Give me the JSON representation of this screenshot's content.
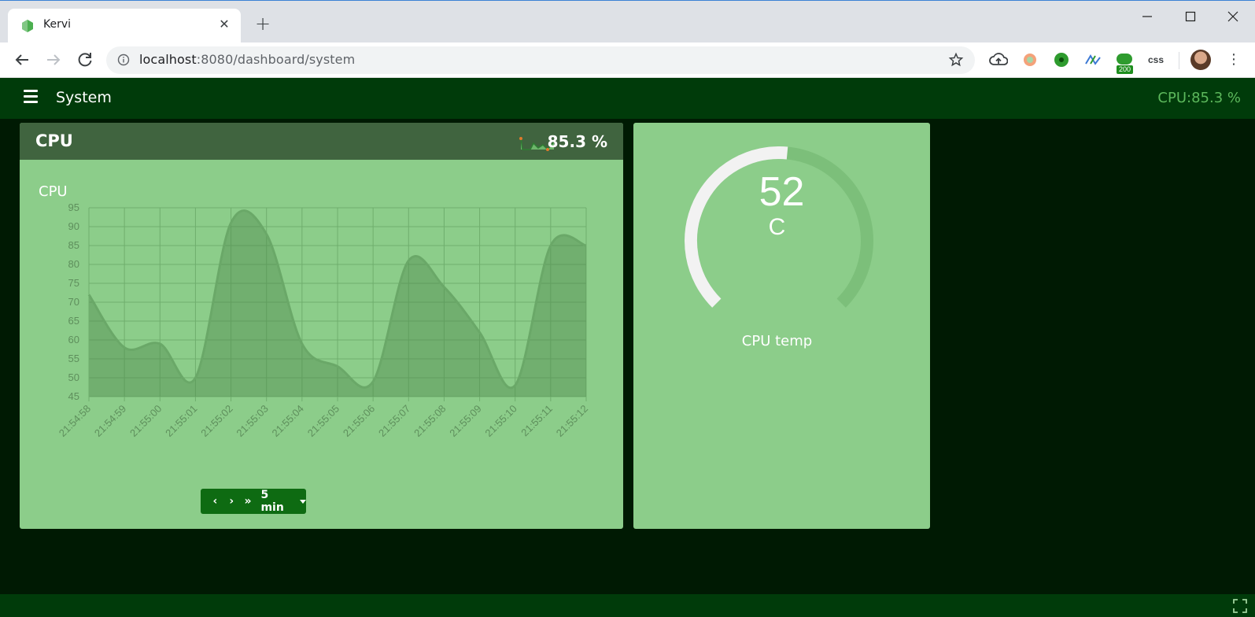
{
  "browser": {
    "tab_title": "Kervi",
    "url_host": "localhost",
    "url_path": ":8080/dashboard/system",
    "extension_badge": "200",
    "css_extension_label": "css"
  },
  "app": {
    "page_title": "System",
    "header_status": "CPU:85.3 %"
  },
  "cpu_panel": {
    "title": "CPU",
    "value": "85.3 %",
    "chart_title": "CPU",
    "range_label": "5 min"
  },
  "temp_panel": {
    "value": "52",
    "unit": "C",
    "label": "CPU temp",
    "gauge_fraction": 0.52
  },
  "colors": {
    "header_bg": "#003b0a",
    "panel_bg": "#8ccd8a",
    "panel_head_bg": "#40643f",
    "accent": "#5cb85c"
  },
  "chart_data": {
    "type": "area",
    "title": "CPU",
    "x": [
      "21:54:58",
      "21:54:59",
      "21:55:00",
      "21:55:01",
      "21:55:02",
      "21:55:03",
      "21:55:04",
      "21:55:05",
      "21:55:06",
      "21:55:07",
      "21:55:08",
      "21:55:09",
      "21:55:10",
      "21:55:11",
      "21:55:12"
    ],
    "values": [
      72,
      58,
      59,
      50,
      91,
      88,
      59,
      53,
      49,
      81,
      74,
      62,
      48,
      85,
      85
    ],
    "ylim": [
      45,
      95
    ],
    "yticks": [
      45,
      50,
      55,
      60,
      65,
      70,
      75,
      80,
      85,
      90,
      95
    ],
    "grid": true,
    "legend": "none"
  }
}
